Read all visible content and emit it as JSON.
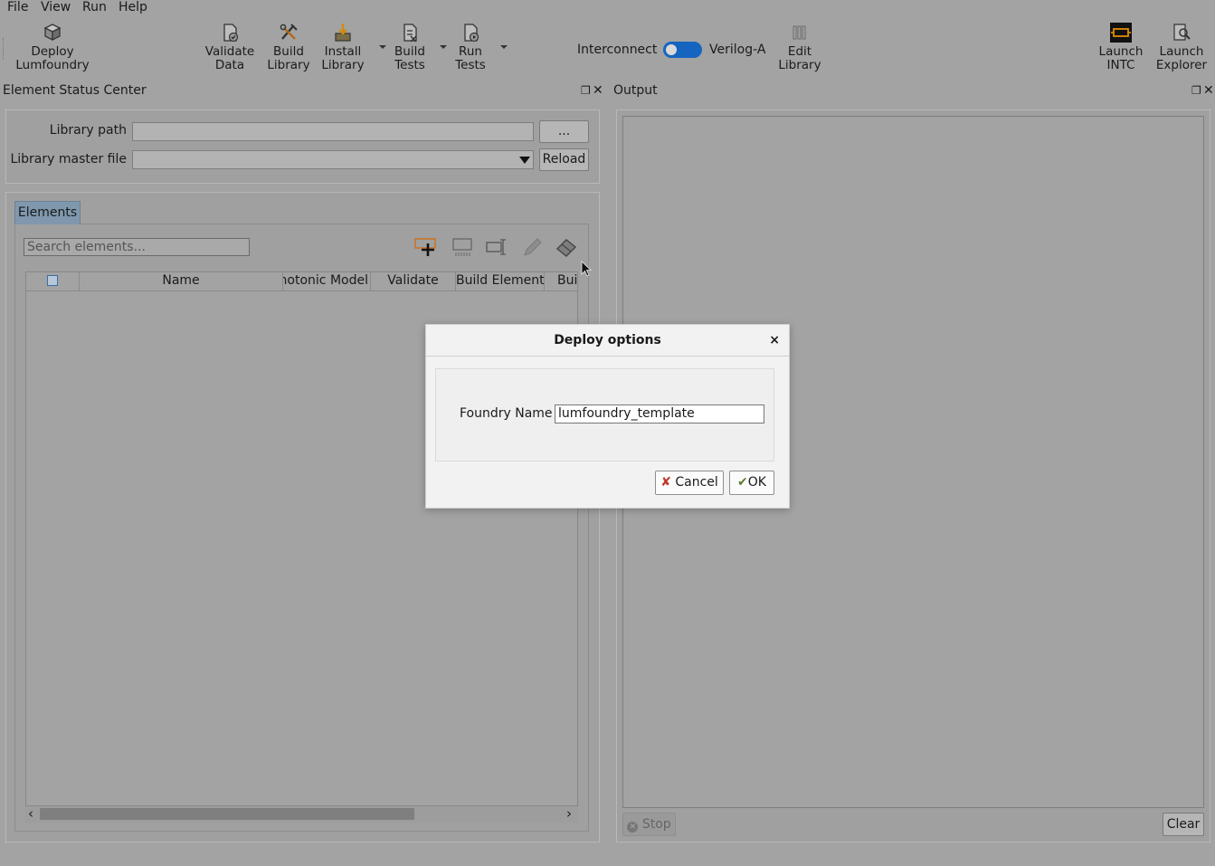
{
  "menu": [
    "File",
    "View",
    "Run",
    "Help"
  ],
  "toolbar": {
    "deploy": [
      "Deploy",
      "Lumfoundry"
    ],
    "validate": [
      "Validate",
      "Data"
    ],
    "build_library": [
      "Build",
      "Library"
    ],
    "install_library": [
      "Install",
      "Library"
    ],
    "build_tests": [
      "Build",
      "Tests"
    ],
    "run_tests": [
      "Run",
      "Tests"
    ],
    "toggle_left": "Interconnect",
    "toggle_right": "Verilog-A",
    "edit_library": [
      "Edit",
      "Library"
    ],
    "launch_intc": [
      "Launch",
      "INTC"
    ],
    "launch_explorer": [
      "Launch",
      "Explorer"
    ]
  },
  "left_dock": {
    "title": "Element Status Center",
    "library_path_label": "Library path",
    "browse_label": "...",
    "master_file_label": "Library master file",
    "reload_label": "Reload",
    "tab": "Elements",
    "search_placeholder": "Search elements...",
    "columns": [
      "Name",
      "Photonic Model",
      "Validate",
      "Build Element",
      "Build"
    ]
  },
  "right_dock": {
    "title": "Output",
    "stop_label": "Stop",
    "clear_label": "Clear"
  },
  "dialog": {
    "title": "Deploy options",
    "close": "×",
    "field_label": "Foundry Name",
    "field_value": "lumfoundry_template",
    "cancel_label": "Cancel",
    "ok_label": "OK"
  },
  "colors": {
    "background": "#a3a3a3",
    "dialog_bg": "#f2f2f2",
    "tab_active": "#7f98ae",
    "toggle": "#1565c0"
  }
}
